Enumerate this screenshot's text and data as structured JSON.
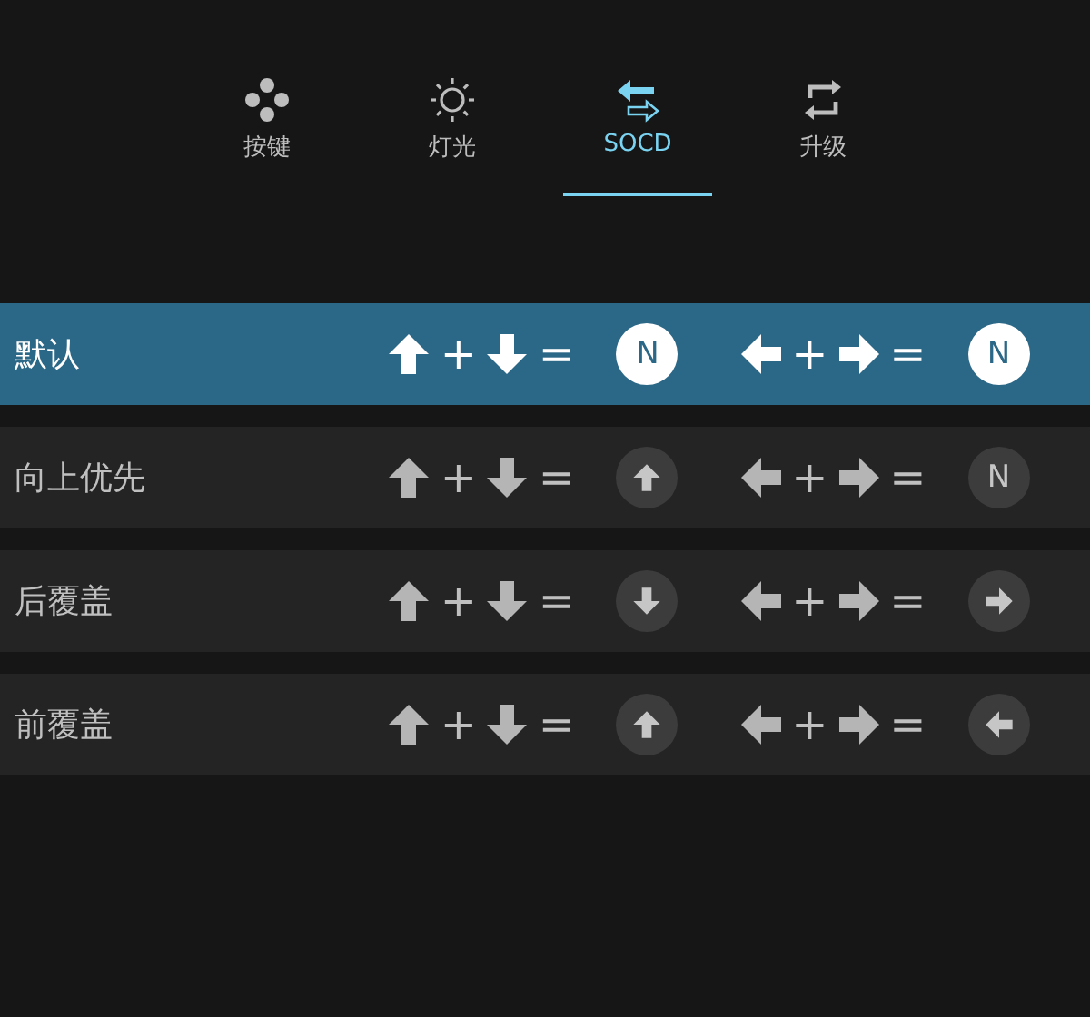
{
  "tabs": [
    {
      "label": "按键",
      "kind": "buttons",
      "selected": false
    },
    {
      "label": "灯光",
      "kind": "light",
      "selected": false
    },
    {
      "label": "SOCD",
      "kind": "socd",
      "selected": true
    },
    {
      "label": "升级",
      "kind": "upgrade",
      "selected": false
    }
  ],
  "modes": [
    {
      "label": "默认",
      "selected": true,
      "vertical": {
        "plus": "+",
        "equals": "=",
        "result": {
          "kind": "text",
          "text": "N"
        }
      },
      "horizontal": {
        "plus": "+",
        "equals": "=",
        "result": {
          "kind": "text",
          "text": "N"
        }
      }
    },
    {
      "label": "向上优先",
      "selected": false,
      "vertical": {
        "plus": "+",
        "equals": "=",
        "result": {
          "kind": "up"
        }
      },
      "horizontal": {
        "plus": "+",
        "equals": "=",
        "result": {
          "kind": "text",
          "text": "N"
        }
      }
    },
    {
      "label": "后覆盖",
      "selected": false,
      "vertical": {
        "plus": "+",
        "equals": "=",
        "result": {
          "kind": "down"
        }
      },
      "horizontal": {
        "plus": "+",
        "equals": "=",
        "result": {
          "kind": "right"
        }
      }
    },
    {
      "label": "前覆盖",
      "selected": false,
      "vertical": {
        "plus": "+",
        "equals": "=",
        "result": {
          "kind": "up"
        }
      },
      "horizontal": {
        "plus": "+",
        "equals": "=",
        "result": {
          "kind": "left"
        }
      }
    }
  ]
}
